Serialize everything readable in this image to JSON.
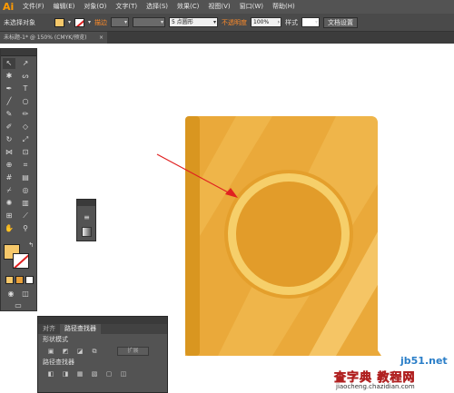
{
  "app": {
    "logo": "Ai"
  },
  "menu": {
    "items": [
      "文件(F)",
      "编辑(E)",
      "对象(O)",
      "文字(T)",
      "选择(S)",
      "效果(C)",
      "视图(V)",
      "窗口(W)",
      "帮助(H)"
    ]
  },
  "control_bar": {
    "selection_label": "未选择对象",
    "stroke_label": "描边",
    "brush_label": "5 点圆形",
    "opacity_label": "不透明度",
    "opacity_value": "100%",
    "style_label": "样式",
    "doc_settings_label": "文档设置"
  },
  "document_tab": {
    "title": "未标题-1* @ 150% (CMYK/预览)",
    "close": "×"
  },
  "pathfinder_panel": {
    "tab_align": "对齐",
    "tab_pathfinder": "路径查找器",
    "shape_modes_label": "形状模式",
    "expand_label": "扩展",
    "pathfinders_label": "路径查找器"
  },
  "colors": {
    "fill": "#f6c86a",
    "book_main": "#eaa93a",
    "book_spine": "#d99620",
    "circle_ring": "#f6cf6a",
    "arrow": "#e02020"
  },
  "watermark": {
    "line1": "jb51.net",
    "line2": "查字典 教程网",
    "line3": "jiaocheng.chazidian.com"
  }
}
